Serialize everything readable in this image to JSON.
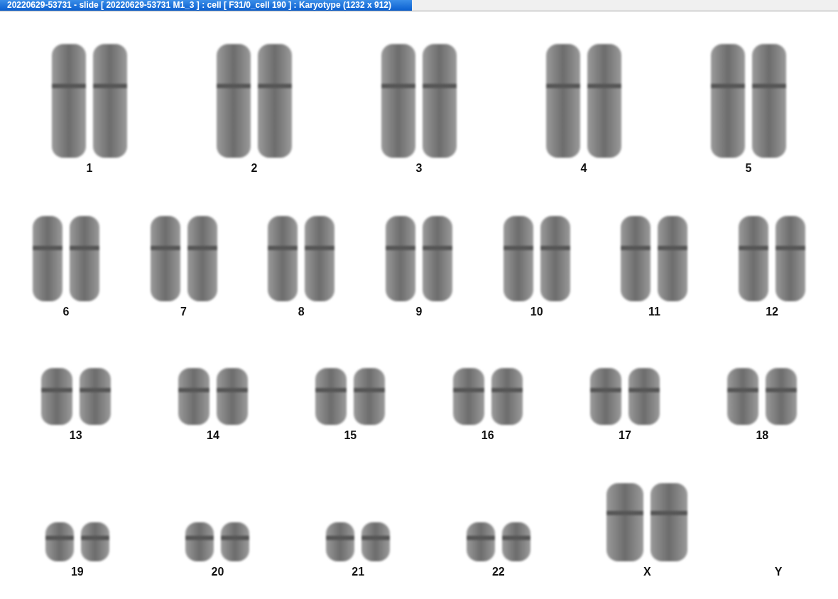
{
  "window": {
    "title": "20220629-53731 - slide [ 20220629-53731 M1_3 ] : cell [ F31/0_cell 190 ] : Karyotype  (1232 x 912)"
  },
  "karyotype": {
    "rows": [
      {
        "items": [
          {
            "label": "1",
            "kind": "pair"
          },
          {
            "label": "2",
            "kind": "pair"
          },
          {
            "label": "3",
            "kind": "pair"
          },
          {
            "label": "4",
            "kind": "pair"
          },
          {
            "label": "5",
            "kind": "pair"
          }
        ]
      },
      {
        "items": [
          {
            "label": "6",
            "kind": "pair"
          },
          {
            "label": "7",
            "kind": "pair"
          },
          {
            "label": "8",
            "kind": "pair"
          },
          {
            "label": "9",
            "kind": "pair"
          },
          {
            "label": "10",
            "kind": "pair"
          },
          {
            "label": "11",
            "kind": "pair"
          },
          {
            "label": "12",
            "kind": "pair"
          }
        ]
      },
      {
        "items": [
          {
            "label": "13",
            "kind": "pair"
          },
          {
            "label": "14",
            "kind": "pair"
          },
          {
            "label": "15",
            "kind": "pair"
          },
          {
            "label": "16",
            "kind": "pair"
          },
          {
            "label": "17",
            "kind": "pair"
          },
          {
            "label": "18",
            "kind": "pair"
          }
        ]
      },
      {
        "items": [
          {
            "label": "19",
            "kind": "pair"
          },
          {
            "label": "20",
            "kind": "pair"
          },
          {
            "label": "21",
            "kind": "pair"
          },
          {
            "label": "22",
            "kind": "pair"
          },
          {
            "label": "X",
            "kind": "large-pair"
          },
          {
            "label": "Y",
            "kind": "empty"
          }
        ]
      }
    ]
  }
}
